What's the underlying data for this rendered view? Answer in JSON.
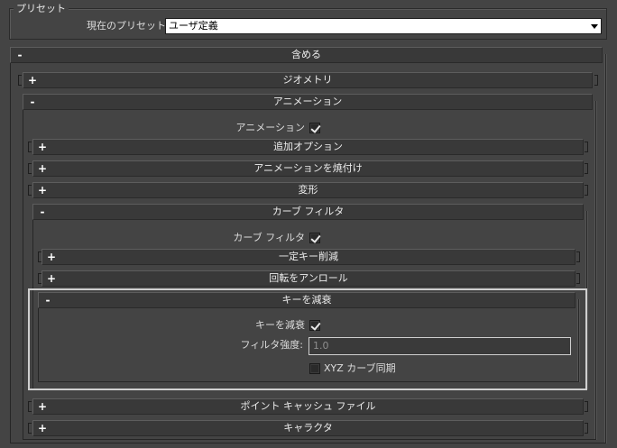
{
  "preset": {
    "group_title": "プリセット",
    "current_label": "現在のプリセット:",
    "current_value": "ユーザ定義"
  },
  "rollouts": {
    "include": {
      "label": "含める",
      "sign": "-"
    },
    "geometry": {
      "label": "ジオメトリ",
      "sign": "+"
    },
    "animation": {
      "label": "アニメーション",
      "sign": "-"
    },
    "animation_check_label": "アニメーション",
    "extra_options": {
      "label": "追加オプション",
      "sign": "+"
    },
    "bake_animation": {
      "label": "アニメーションを焼付け",
      "sign": "+"
    },
    "deform": {
      "label": "変形",
      "sign": "+"
    },
    "curve_filter": {
      "label": "カーブ フィルタ",
      "sign": "-"
    },
    "curve_filter_check_label": "カーブ フィルタ",
    "constant_key_reducer": {
      "label": "一定キー削減",
      "sign": "+"
    },
    "unroll_rotation": {
      "label": "回転をアンロール",
      "sign": "+"
    },
    "key_reducer": {
      "label": "キーを減衰",
      "sign": "-"
    },
    "key_reducer_check_label": "キーを減衰",
    "filter_strength_label": "フィルタ強度:",
    "filter_strength_value": "1.0",
    "xyz_sync_label": "XYZ カーブ同期",
    "point_cache": {
      "label": "ポイント キャッシュ ファイル",
      "sign": "+"
    },
    "character": {
      "label": "キャラクタ",
      "sign": "+"
    }
  },
  "state": {
    "animation_checked": true,
    "curve_filter_checked": true,
    "key_reducer_checked": true,
    "xyz_sync_checked": false
  }
}
